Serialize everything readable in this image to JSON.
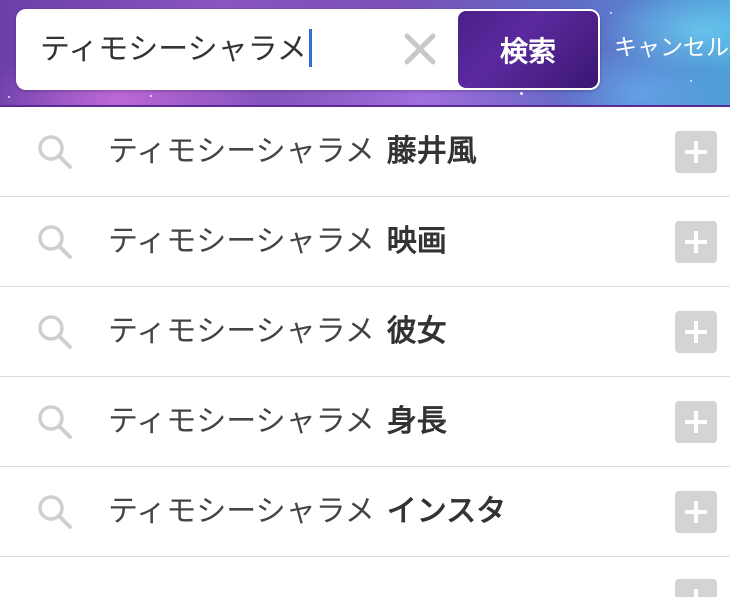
{
  "search": {
    "query": "ティモシーシャラメ",
    "submit_label": "検索",
    "cancel_label": "キャンセル"
  },
  "suggestions": [
    {
      "prefix": "ティモシーシャラメ",
      "suffix": "藤井風"
    },
    {
      "prefix": "ティモシーシャラメ",
      "suffix": "映画"
    },
    {
      "prefix": "ティモシーシャラメ",
      "suffix": "彼女"
    },
    {
      "prefix": "ティモシーシャラメ",
      "suffix": "身長"
    },
    {
      "prefix": "ティモシーシャラメ",
      "suffix": "インスタ"
    }
  ],
  "colors": {
    "header_accent": "#5b2c97",
    "search_button": "#4b1f8a",
    "caret": "#2f6fd8",
    "add_button": "#d4d4d4"
  },
  "icons": {
    "clear": "close-icon",
    "suggestion": "search-icon",
    "add": "plus-icon"
  }
}
